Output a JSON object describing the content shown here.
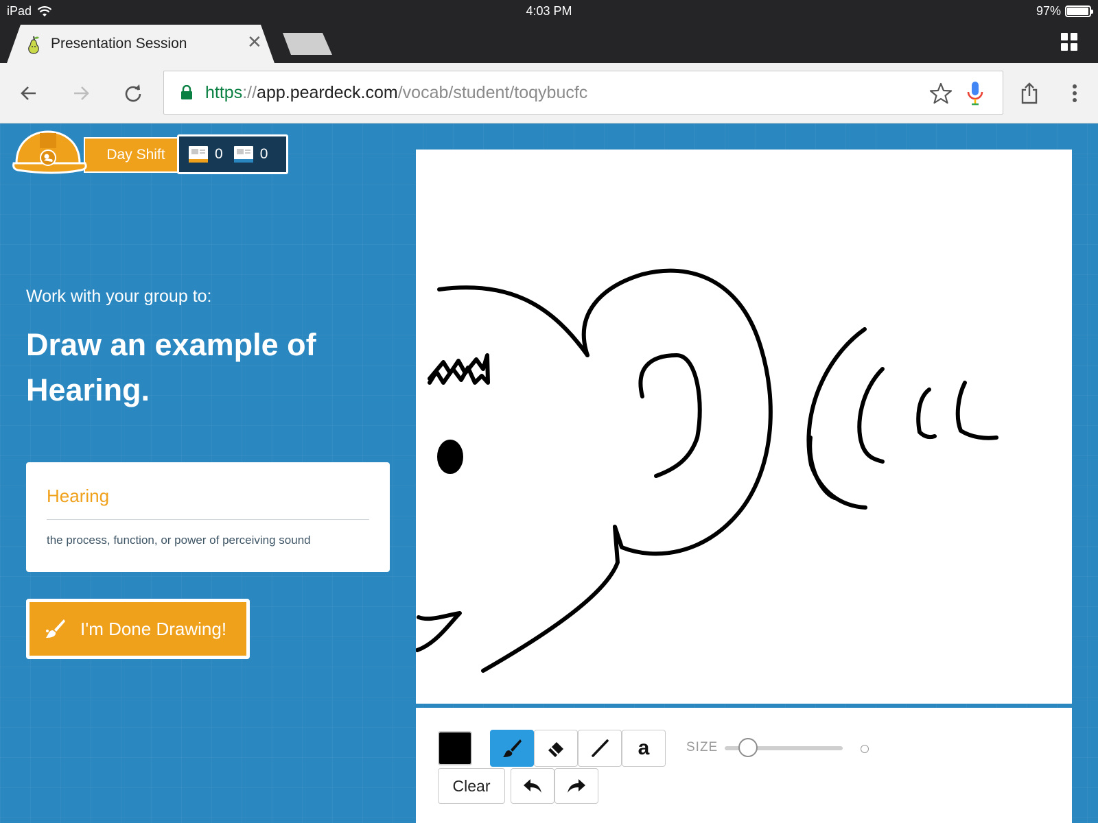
{
  "status_bar": {
    "device": "iPad",
    "time": "4:03 PM",
    "battery_text": "97%",
    "battery_level": 0.97
  },
  "browser": {
    "tab": {
      "title": "Presentation Session",
      "close_glyph": "✕",
      "icon": "peardeck-pear-icon"
    },
    "url": {
      "scheme": "https",
      "sep": "://",
      "host": "app.peardeck.com",
      "path": "/vocab/student/toqybucfc"
    },
    "icons": [
      "back-arrow-icon",
      "forward-arrow-icon",
      "reload-icon",
      "lock-icon",
      "star-icon",
      "mic-icon",
      "share-icon",
      "more-vert-icon",
      "tab-switcher-icon"
    ]
  },
  "header": {
    "shift_label": "Day Shift",
    "count_a": "0",
    "count_b": "0",
    "count_a_color": "#f0a11c",
    "count_b_color": "#2b87bf"
  },
  "prompt": {
    "intro": "Work with your group to:",
    "main": "Draw an example of Hearing."
  },
  "vocab_card": {
    "term": "Hearing",
    "definition": "the process, function, or power of perceiving sound"
  },
  "done_button": {
    "label": "I'm Done Drawing!"
  },
  "tools": {
    "color": "#000000",
    "active_tool": "brush",
    "text_tool_glyph": "a",
    "clear_label": "Clear",
    "size_label": "SIZE",
    "size_value": 0.2
  },
  "colors": {
    "page_blue": "#2b87bf",
    "accent_orange": "#f0a11c",
    "active_tool_blue": "#2b9be0",
    "dark_navy": "#163a56"
  }
}
